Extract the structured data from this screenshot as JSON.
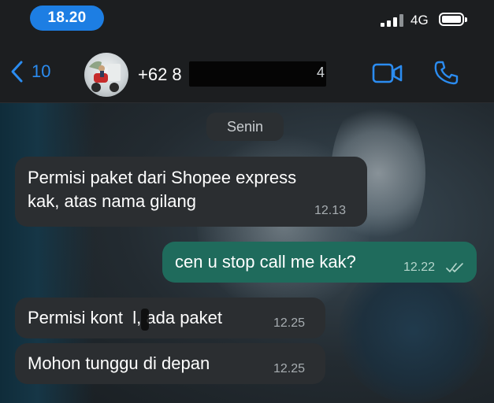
{
  "status_bar": {
    "time": "18.20",
    "network": "4G"
  },
  "header": {
    "back_count": "10",
    "contact_name": "+62 8",
    "contact_name_tail": "4"
  },
  "chat": {
    "date_label": "Senin",
    "messages": [
      {
        "direction": "incoming",
        "text": "Permisi paket dari Shopee express\nkak, atas nama gilang",
        "time": "12.13"
      },
      {
        "direction": "outgoing",
        "text": "cen u stop call me kak?",
        "time": "12.22",
        "status": "read"
      },
      {
        "direction": "incoming",
        "text": "Permisi kont  l, ada paket",
        "time": "12.25"
      },
      {
        "direction": "incoming",
        "text": "Mohon tunggu di depan",
        "time": "12.25"
      }
    ]
  },
  "colors": {
    "accent": "#2b8cf0",
    "time_pill": "#1d7ee3",
    "incoming_bubble": "#2b2e31",
    "outgoing_bubble": "#1f6b5c"
  },
  "icons": [
    "chevron-left-icon",
    "video-camera-icon",
    "phone-icon",
    "signal-icon",
    "battery-icon",
    "double-check-icon"
  ]
}
